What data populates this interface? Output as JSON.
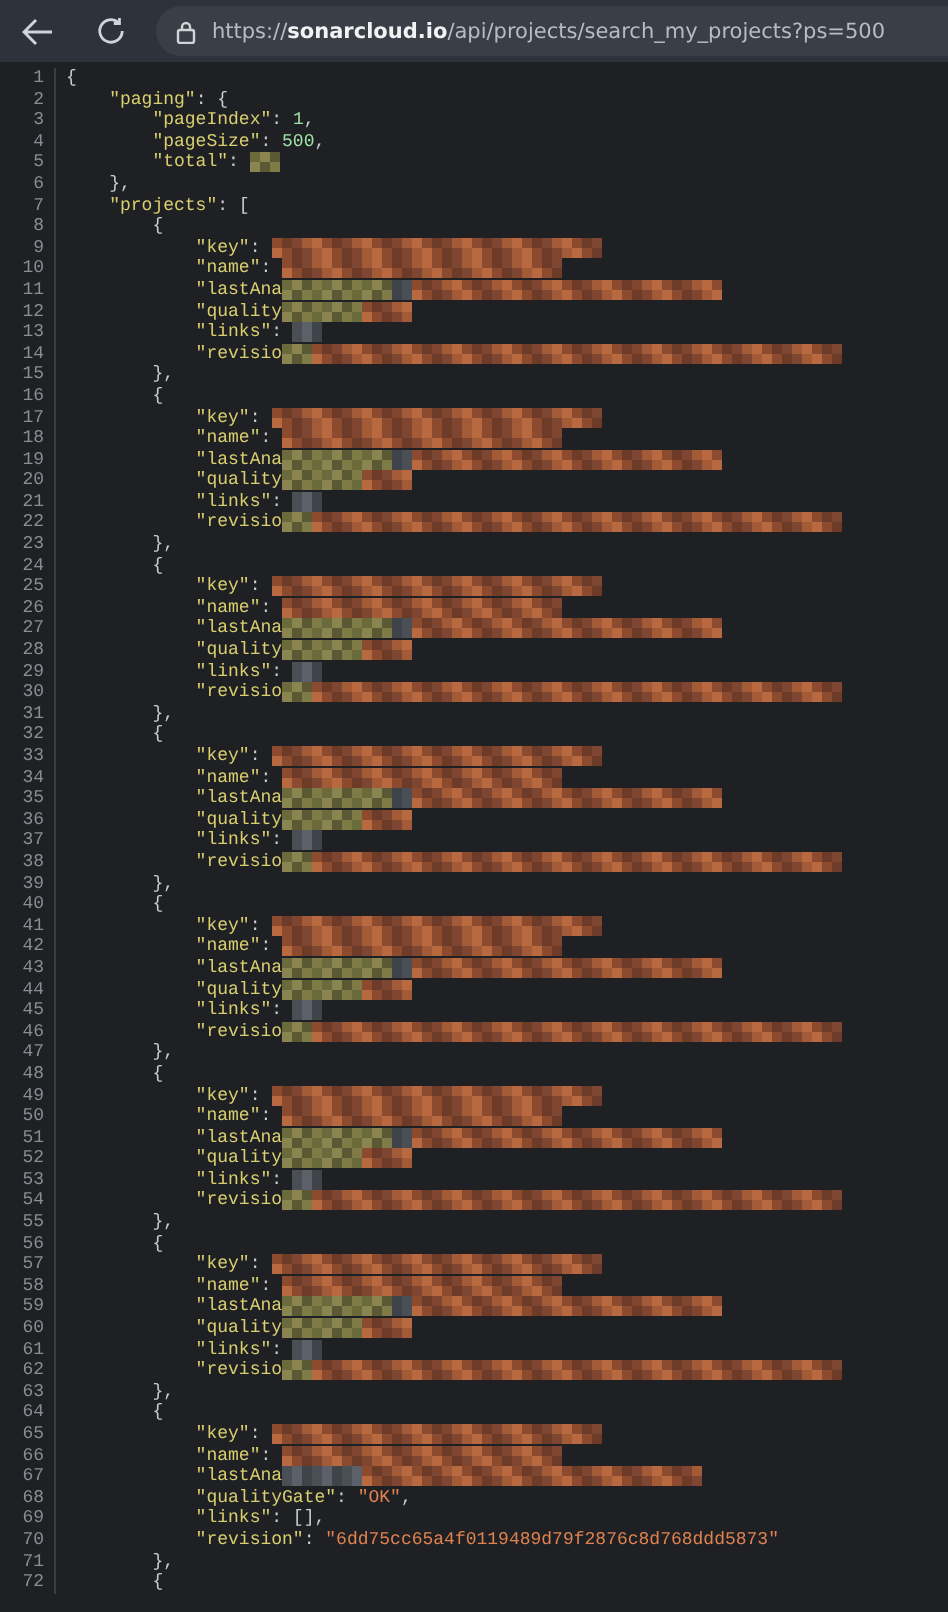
{
  "address_bar": {
    "scheme": "https://",
    "host": "sonarcloud.io",
    "path": "/api/projects/search_my_projects?ps=500"
  },
  "code_lines": [
    {
      "n": "1",
      "tokens": [
        {
          "kind": "punct",
          "text": "{"
        }
      ]
    },
    {
      "n": "2",
      "tokens": [
        {
          "kind": "key",
          "text": "    \"paging\""
        },
        {
          "kind": "punct",
          "text": ": {"
        }
      ]
    },
    {
      "n": "3",
      "tokens": [
        {
          "kind": "key",
          "text": "        \"pageIndex\""
        },
        {
          "kind": "punct",
          "text": ": "
        },
        {
          "kind": "num",
          "text": "1"
        },
        {
          "kind": "punct",
          "text": ","
        }
      ]
    },
    {
      "n": "4",
      "tokens": [
        {
          "kind": "key",
          "text": "        \"pageSize\""
        },
        {
          "kind": "punct",
          "text": ": "
        },
        {
          "kind": "num",
          "text": "500"
        },
        {
          "kind": "punct",
          "text": ","
        }
      ]
    },
    {
      "n": "5",
      "tokens": [
        {
          "kind": "key",
          "text": "        \"total\""
        },
        {
          "kind": "punct",
          "text": ": "
        },
        {
          "kind": "redacted"
        }
      ]
    },
    {
      "n": "6",
      "tokens": [
        {
          "kind": "punct",
          "text": "    },"
        }
      ]
    },
    {
      "n": "7",
      "tokens": [
        {
          "kind": "key",
          "text": "    \"projects\""
        },
        {
          "kind": "punct",
          "text": ": ["
        }
      ]
    },
    {
      "n": "8",
      "tokens": [
        {
          "kind": "punct",
          "text": "        {"
        }
      ]
    },
    {
      "n": "9",
      "tokens": [
        {
          "kind": "key",
          "text": "            \"key\""
        },
        {
          "kind": "punct",
          "text": ": "
        },
        {
          "kind": "redacted"
        }
      ]
    },
    {
      "n": "10",
      "tokens": [
        {
          "kind": "key",
          "text": "            \"name\""
        },
        {
          "kind": "punct",
          "text": ": "
        },
        {
          "kind": "redacted"
        }
      ]
    },
    {
      "n": "11",
      "tokens": [
        {
          "kind": "key",
          "text": "            \"lastAna"
        },
        {
          "kind": "redacted"
        }
      ]
    },
    {
      "n": "12",
      "tokens": [
        {
          "kind": "key",
          "text": "            \"quality"
        },
        {
          "kind": "redacted"
        }
      ]
    },
    {
      "n": "13",
      "tokens": [
        {
          "kind": "key",
          "text": "            \"links\""
        },
        {
          "kind": "punct",
          "text": ": "
        },
        {
          "kind": "redacted"
        }
      ]
    },
    {
      "n": "14",
      "tokens": [
        {
          "kind": "key",
          "text": "            \"revisio"
        },
        {
          "kind": "redacted"
        }
      ]
    },
    {
      "n": "15",
      "tokens": [
        {
          "kind": "punct",
          "text": "        },"
        }
      ]
    },
    {
      "n": "16",
      "tokens": [
        {
          "kind": "punct",
          "text": "        {"
        }
      ]
    },
    {
      "n": "17",
      "tokens": [
        {
          "kind": "key",
          "text": "            \"key\""
        },
        {
          "kind": "punct",
          "text": ": "
        },
        {
          "kind": "redacted"
        }
      ]
    },
    {
      "n": "18",
      "tokens": [
        {
          "kind": "key",
          "text": "            \"name\""
        },
        {
          "kind": "punct",
          "text": ": "
        },
        {
          "kind": "redacted"
        }
      ]
    },
    {
      "n": "19",
      "tokens": [
        {
          "kind": "key",
          "text": "            \"lastAna"
        },
        {
          "kind": "redacted"
        }
      ]
    },
    {
      "n": "20",
      "tokens": [
        {
          "kind": "key",
          "text": "            \"quality"
        },
        {
          "kind": "redacted"
        }
      ]
    },
    {
      "n": "21",
      "tokens": [
        {
          "kind": "key",
          "text": "            \"links\""
        },
        {
          "kind": "punct",
          "text": ": "
        },
        {
          "kind": "redacted"
        }
      ]
    },
    {
      "n": "22",
      "tokens": [
        {
          "kind": "key",
          "text": "            \"revisio"
        },
        {
          "kind": "redacted"
        }
      ]
    },
    {
      "n": "23",
      "tokens": [
        {
          "kind": "punct",
          "text": "        },"
        }
      ]
    },
    {
      "n": "24",
      "tokens": [
        {
          "kind": "punct",
          "text": "        {"
        }
      ]
    },
    {
      "n": "25",
      "tokens": [
        {
          "kind": "key",
          "text": "            \"key\""
        },
        {
          "kind": "punct",
          "text": ": "
        },
        {
          "kind": "redacted"
        }
      ]
    },
    {
      "n": "26",
      "tokens": [
        {
          "kind": "key",
          "text": "            \"name\""
        },
        {
          "kind": "punct",
          "text": ": "
        },
        {
          "kind": "redacted"
        }
      ]
    },
    {
      "n": "27",
      "tokens": [
        {
          "kind": "key",
          "text": "            \"lastAna"
        },
        {
          "kind": "redacted"
        }
      ]
    },
    {
      "n": "28",
      "tokens": [
        {
          "kind": "key",
          "text": "            \"quality"
        },
        {
          "kind": "redacted"
        }
      ]
    },
    {
      "n": "29",
      "tokens": [
        {
          "kind": "key",
          "text": "            \"links\""
        },
        {
          "kind": "punct",
          "text": ": "
        },
        {
          "kind": "redacted"
        }
      ]
    },
    {
      "n": "30",
      "tokens": [
        {
          "kind": "key",
          "text": "            \"revisio"
        },
        {
          "kind": "redacted"
        }
      ]
    },
    {
      "n": "31",
      "tokens": [
        {
          "kind": "punct",
          "text": "        },"
        }
      ]
    },
    {
      "n": "32",
      "tokens": [
        {
          "kind": "punct",
          "text": "        {"
        }
      ]
    },
    {
      "n": "33",
      "tokens": [
        {
          "kind": "key",
          "text": "            \"key\""
        },
        {
          "kind": "punct",
          "text": ": "
        },
        {
          "kind": "redacted"
        }
      ]
    },
    {
      "n": "34",
      "tokens": [
        {
          "kind": "key",
          "text": "            \"name\""
        },
        {
          "kind": "punct",
          "text": ": "
        },
        {
          "kind": "redacted"
        }
      ]
    },
    {
      "n": "35",
      "tokens": [
        {
          "kind": "key",
          "text": "            \"lastAna"
        },
        {
          "kind": "redacted"
        }
      ]
    },
    {
      "n": "36",
      "tokens": [
        {
          "kind": "key",
          "text": "            \"quality"
        },
        {
          "kind": "redacted"
        }
      ]
    },
    {
      "n": "37",
      "tokens": [
        {
          "kind": "key",
          "text": "            \"links\""
        },
        {
          "kind": "punct",
          "text": ": "
        },
        {
          "kind": "redacted"
        }
      ]
    },
    {
      "n": "38",
      "tokens": [
        {
          "kind": "key",
          "text": "            \"revisio"
        },
        {
          "kind": "redacted"
        }
      ]
    },
    {
      "n": "39",
      "tokens": [
        {
          "kind": "punct",
          "text": "        },"
        }
      ]
    },
    {
      "n": "40",
      "tokens": [
        {
          "kind": "punct",
          "text": "        {"
        }
      ]
    },
    {
      "n": "41",
      "tokens": [
        {
          "kind": "key",
          "text": "            \"key\""
        },
        {
          "kind": "punct",
          "text": ": "
        },
        {
          "kind": "redacted"
        }
      ]
    },
    {
      "n": "42",
      "tokens": [
        {
          "kind": "key",
          "text": "            \"name\""
        },
        {
          "kind": "punct",
          "text": ": "
        },
        {
          "kind": "redacted"
        }
      ]
    },
    {
      "n": "43",
      "tokens": [
        {
          "kind": "key",
          "text": "            \"lastAna"
        },
        {
          "kind": "redacted"
        }
      ]
    },
    {
      "n": "44",
      "tokens": [
        {
          "kind": "key",
          "text": "            \"quality"
        },
        {
          "kind": "redacted"
        }
      ]
    },
    {
      "n": "45",
      "tokens": [
        {
          "kind": "key",
          "text": "            \"links\""
        },
        {
          "kind": "punct",
          "text": ": "
        },
        {
          "kind": "redacted"
        }
      ]
    },
    {
      "n": "46",
      "tokens": [
        {
          "kind": "key",
          "text": "            \"revisio"
        },
        {
          "kind": "redacted"
        }
      ]
    },
    {
      "n": "47",
      "tokens": [
        {
          "kind": "punct",
          "text": "        },"
        }
      ]
    },
    {
      "n": "48",
      "tokens": [
        {
          "kind": "punct",
          "text": "        {"
        }
      ]
    },
    {
      "n": "49",
      "tokens": [
        {
          "kind": "key",
          "text": "            \"key\""
        },
        {
          "kind": "punct",
          "text": ": "
        },
        {
          "kind": "redacted"
        }
      ]
    },
    {
      "n": "50",
      "tokens": [
        {
          "kind": "key",
          "text": "            \"name\""
        },
        {
          "kind": "punct",
          "text": ": "
        },
        {
          "kind": "redacted"
        }
      ]
    },
    {
      "n": "51",
      "tokens": [
        {
          "kind": "key",
          "text": "            \"lastAna"
        },
        {
          "kind": "redacted"
        }
      ]
    },
    {
      "n": "52",
      "tokens": [
        {
          "kind": "key",
          "text": "            \"quality"
        },
        {
          "kind": "redacted"
        }
      ]
    },
    {
      "n": "53",
      "tokens": [
        {
          "kind": "key",
          "text": "            \"links\""
        },
        {
          "kind": "punct",
          "text": ": "
        },
        {
          "kind": "redacted"
        }
      ]
    },
    {
      "n": "54",
      "tokens": [
        {
          "kind": "key",
          "text": "            \"revisio"
        },
        {
          "kind": "redacted"
        }
      ]
    },
    {
      "n": "55",
      "tokens": [
        {
          "kind": "punct",
          "text": "        },"
        }
      ]
    },
    {
      "n": "56",
      "tokens": [
        {
          "kind": "punct",
          "text": "        {"
        }
      ]
    },
    {
      "n": "57",
      "tokens": [
        {
          "kind": "key",
          "text": "            \"key\""
        },
        {
          "kind": "punct",
          "text": ": "
        },
        {
          "kind": "redacted"
        }
      ]
    },
    {
      "n": "58",
      "tokens": [
        {
          "kind": "key",
          "text": "            \"name\""
        },
        {
          "kind": "punct",
          "text": ": "
        },
        {
          "kind": "redacted"
        }
      ]
    },
    {
      "n": "59",
      "tokens": [
        {
          "kind": "key",
          "text": "            \"lastAna"
        },
        {
          "kind": "redacted"
        }
      ]
    },
    {
      "n": "60",
      "tokens": [
        {
          "kind": "key",
          "text": "            \"quality"
        },
        {
          "kind": "redacted"
        }
      ]
    },
    {
      "n": "61",
      "tokens": [
        {
          "kind": "key",
          "text": "            \"links\""
        },
        {
          "kind": "punct",
          "text": ": "
        },
        {
          "kind": "redacted"
        }
      ]
    },
    {
      "n": "62",
      "tokens": [
        {
          "kind": "key",
          "text": "            \"revisio"
        },
        {
          "kind": "redacted"
        }
      ]
    },
    {
      "n": "63",
      "tokens": [
        {
          "kind": "punct",
          "text": "        },"
        }
      ]
    },
    {
      "n": "64",
      "tokens": [
        {
          "kind": "punct",
          "text": "        {"
        }
      ]
    },
    {
      "n": "65",
      "tokens": [
        {
          "kind": "key",
          "text": "            \"key\""
        },
        {
          "kind": "punct",
          "text": ": "
        },
        {
          "kind": "redacted"
        }
      ]
    },
    {
      "n": "66",
      "tokens": [
        {
          "kind": "key",
          "text": "            \"name\""
        },
        {
          "kind": "punct",
          "text": ": "
        },
        {
          "kind": "redacted"
        }
      ]
    },
    {
      "n": "67",
      "tokens": [
        {
          "kind": "key",
          "text": "            \"lastAna"
        },
        {
          "kind": "redacted"
        }
      ]
    },
    {
      "n": "68",
      "tokens": [
        {
          "kind": "key",
          "text": "            \"qualityGate\""
        },
        {
          "kind": "punct",
          "text": ": "
        },
        {
          "kind": "str",
          "text": "\"OK\""
        },
        {
          "kind": "punct",
          "text": ","
        }
      ]
    },
    {
      "n": "69",
      "tokens": [
        {
          "kind": "key",
          "text": "            \"links\""
        },
        {
          "kind": "punct",
          "text": ": [],"
        }
      ]
    },
    {
      "n": "70",
      "tokens": [
        {
          "kind": "key",
          "text": "            \"revision\""
        },
        {
          "kind": "punct",
          "text": ": "
        },
        {
          "kind": "str",
          "text": "\"6dd75cc65a4f0119489d79f2876c8d768ddd5873\""
        }
      ]
    },
    {
      "n": "71",
      "tokens": [
        {
          "kind": "punct",
          "text": "        },"
        }
      ]
    },
    {
      "n": "72",
      "tokens": [
        {
          "kind": "punct",
          "text": "        {"
        }
      ]
    }
  ]
}
